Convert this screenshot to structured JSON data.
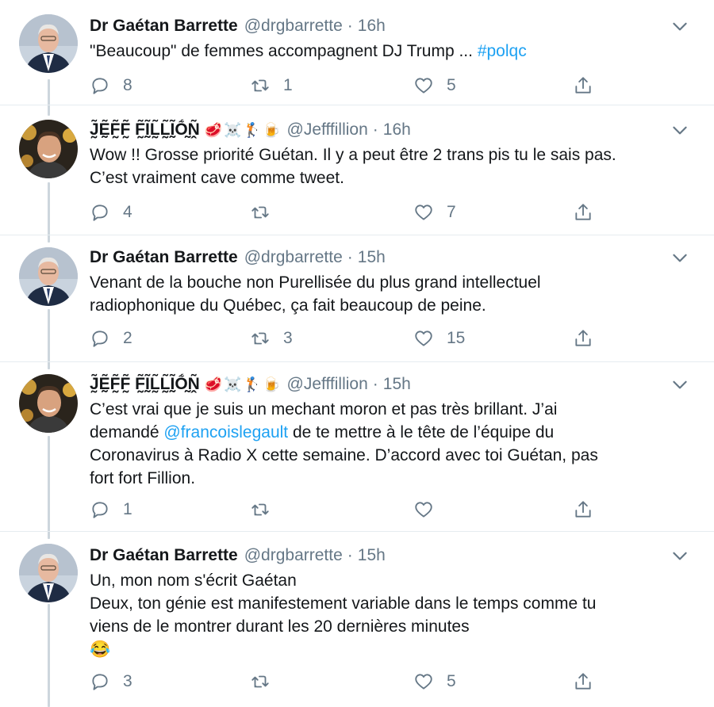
{
  "tweets": [
    {
      "author": "Dr Gaétan Barrette",
      "handle": "@drgbarrette",
      "time": "16h",
      "text": "\"Beaucoup\" de femmes accompagnent DJ Trump ... ",
      "hashtag": "#polqc",
      "replies": "8",
      "retweets": "1",
      "likes": "5"
    },
    {
      "author": "J̰̃Ḛ̃F̰̃F̰̃ F̰̃Ḭ̃L̰̃L̰̃Ḭ̃Ṍ̰Ṋ̃",
      "emojis": [
        "🥩",
        "☠️",
        "🏌️",
        "🍺"
      ],
      "handle": "@Jefffillion",
      "time": "16h",
      "text_lines": [
        "Wow !! Grosse priorité Guétan. Il y a peut être 2 trans pis tu le sais pas.",
        "C’est vraiment cave comme tweet."
      ],
      "replies": "4",
      "retweets": "",
      "likes": "7"
    },
    {
      "author": "Dr Gaétan Barrette",
      "handle": "@drgbarrette",
      "time": "15h",
      "text_lines": [
        "Venant de la bouche non Purellisée du plus grand intellectuel",
        "radiophonique du Québec, ça fait beaucoup de peine."
      ],
      "replies": "2",
      "retweets": "3",
      "likes": "15"
    },
    {
      "author": "J̰̃Ḛ̃F̰̃F̰̃ F̰̃Ḭ̃L̰̃L̰̃Ḭ̃Ṍ̰Ṋ̃",
      "emojis": [
        "🥩",
        "☠️",
        "🏌️",
        "🍺"
      ],
      "handle": "@Jefffillion",
      "time": "15h",
      "line1": "C’est vrai que je suis un mechant moron et pas très brillant. J’ai",
      "line2_pre": "demandé ",
      "mention": "@francoislegault",
      "line2_post": " de te mettre à le tête de l’équipe du",
      "line3": "Coronavirus à Radio X cette semaine. D’accord avec toi Guétan, pas",
      "line4": "fort fort Fillion.",
      "replies": "1",
      "retweets": "",
      "likes": ""
    },
    {
      "author": "Dr Gaétan Barrette",
      "handle": "@drgbarrette",
      "time": "15h",
      "text_lines": [
        "Un, mon nom s'écrit Gaétan",
        "Deux, ton génie est manifestement variable dans le temps comme tu",
        "viens de le montrer durant les 20 dernières minutes",
        "😂"
      ],
      "replies": "3",
      "retweets": "",
      "likes": "5"
    }
  ],
  "separator": "·",
  "colors": {
    "link": "#1da1f2",
    "muted": "#657786",
    "thread": "#cdd6dd"
  }
}
